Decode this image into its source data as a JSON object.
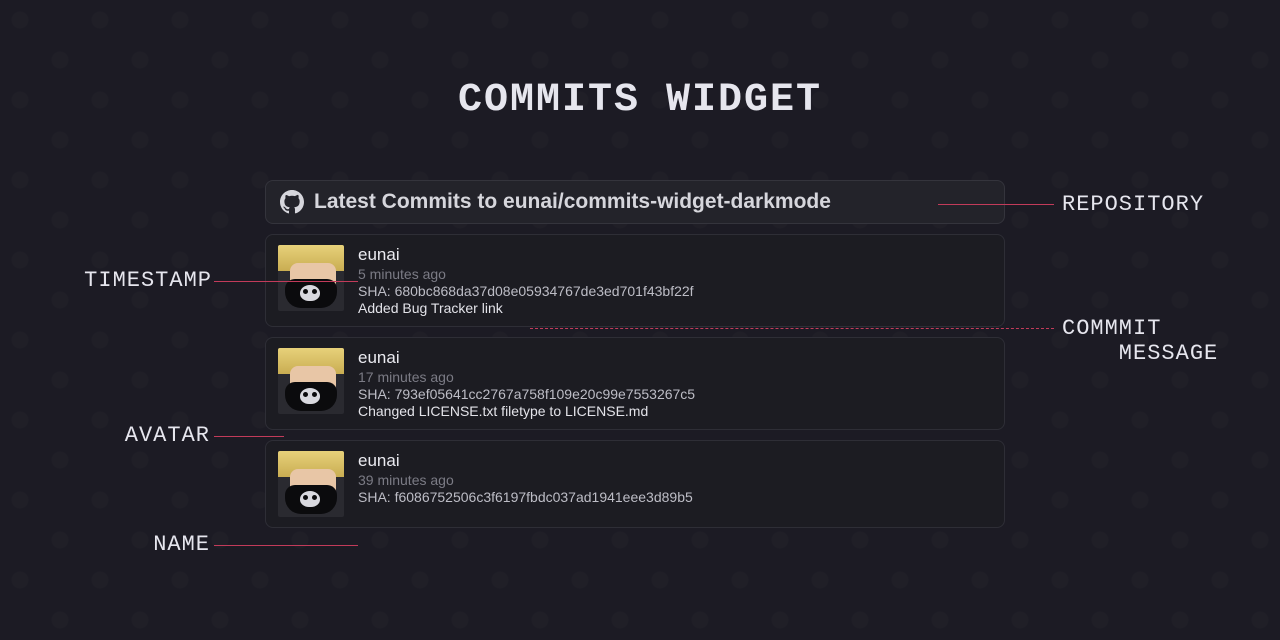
{
  "title": "COMMITS WIDGET",
  "header": {
    "prefix": "Latest Commits to ",
    "repo": "eunai/commits-widget-darkmode"
  },
  "commits": [
    {
      "name": "eunai",
      "time": "5 minutes ago",
      "sha": "680bc868da37d08e05934767de3ed701f43bf22f",
      "msg": "Added Bug Tracker link"
    },
    {
      "name": "eunai",
      "time": "17 minutes ago",
      "sha": "793ef05641cc2767a758f109e20c99e7553267c5",
      "msg": "Changed LICENSE.txt filetype to LICENSE.md"
    },
    {
      "name": "eunai",
      "time": "39 minutes ago",
      "sha": "f6086752506c3f6197fbdc037ad1941eee3d89b5",
      "msg": ""
    }
  ],
  "callouts": {
    "repository": "REPOSITORY",
    "commit_message": "COMMMIT\n    MESSAGE",
    "timestamp": "TIMESTAMP",
    "avatar": "AVATAR",
    "name": "NAME"
  },
  "sha_prefix": "SHA: "
}
